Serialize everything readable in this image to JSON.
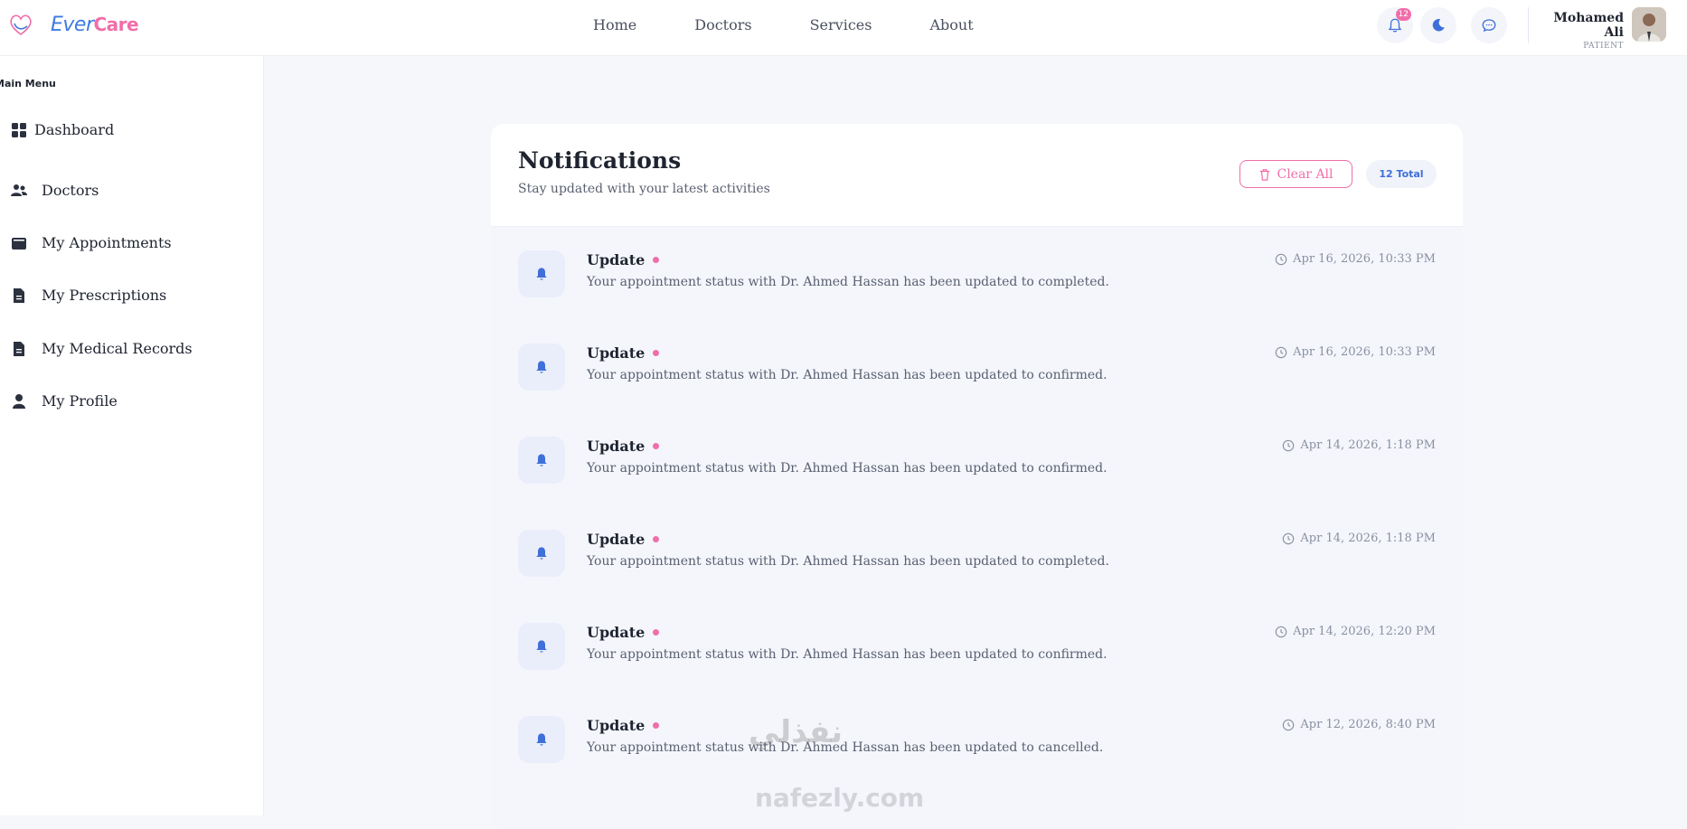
{
  "brand": {
    "part1": "Ever",
    "part2": "Care"
  },
  "nav": [
    {
      "label": "Home"
    },
    {
      "label": "Doctors"
    },
    {
      "label": "Services"
    },
    {
      "label": "About"
    }
  ],
  "header": {
    "notification_count": "12",
    "user_name": "Mohamed Ali",
    "user_role": "PATIENT"
  },
  "sidebar": {
    "title": "Main Menu",
    "items": [
      {
        "label": "Dashboard",
        "icon": "grid-icon"
      },
      {
        "label": "Doctors",
        "icon": "users-icon"
      },
      {
        "label": "My Appointments",
        "icon": "wallet-icon"
      },
      {
        "label": "My Prescriptions",
        "icon": "file-icon"
      },
      {
        "label": "My Medical Records",
        "icon": "file-icon"
      },
      {
        "label": "My Profile",
        "icon": "user-icon"
      }
    ]
  },
  "notifications": {
    "title": "Notifications",
    "subtitle": "Stay updated with your latest activities",
    "clear_label": "Clear All",
    "total_label": "12 Total",
    "items": [
      {
        "title": "Update",
        "message": "Your appointment status with Dr. Ahmed Hassan has been updated to completed.",
        "time": "Apr 16, 2026, 10:33 PM"
      },
      {
        "title": "Update",
        "message": "Your appointment status with Dr. Ahmed Hassan has been updated to confirmed.",
        "time": "Apr 16, 2026, 10:33 PM"
      },
      {
        "title": "Update",
        "message": "Your appointment status with Dr. Ahmed Hassan has been updated to confirmed.",
        "time": "Apr 14, 2026, 1:18 PM"
      },
      {
        "title": "Update",
        "message": "Your appointment status with Dr. Ahmed Hassan has been updated to completed.",
        "time": "Apr 14, 2026, 1:18 PM"
      },
      {
        "title": "Update",
        "message": "Your appointment status with Dr. Ahmed Hassan has been updated to confirmed.",
        "time": "Apr 14, 2026, 12:20 PM"
      },
      {
        "title": "Update",
        "message": "Your appointment status with Dr. Ahmed Hassan has been updated to cancelled.",
        "time": "Apr 12, 2026, 8:40 PM"
      }
    ]
  },
  "watermark": {
    "arabic": "نفذلي",
    "latin": "nafezly.com"
  },
  "colors": {
    "accent_pink": "#f06ea9",
    "accent_blue": "#3f6fd8"
  }
}
